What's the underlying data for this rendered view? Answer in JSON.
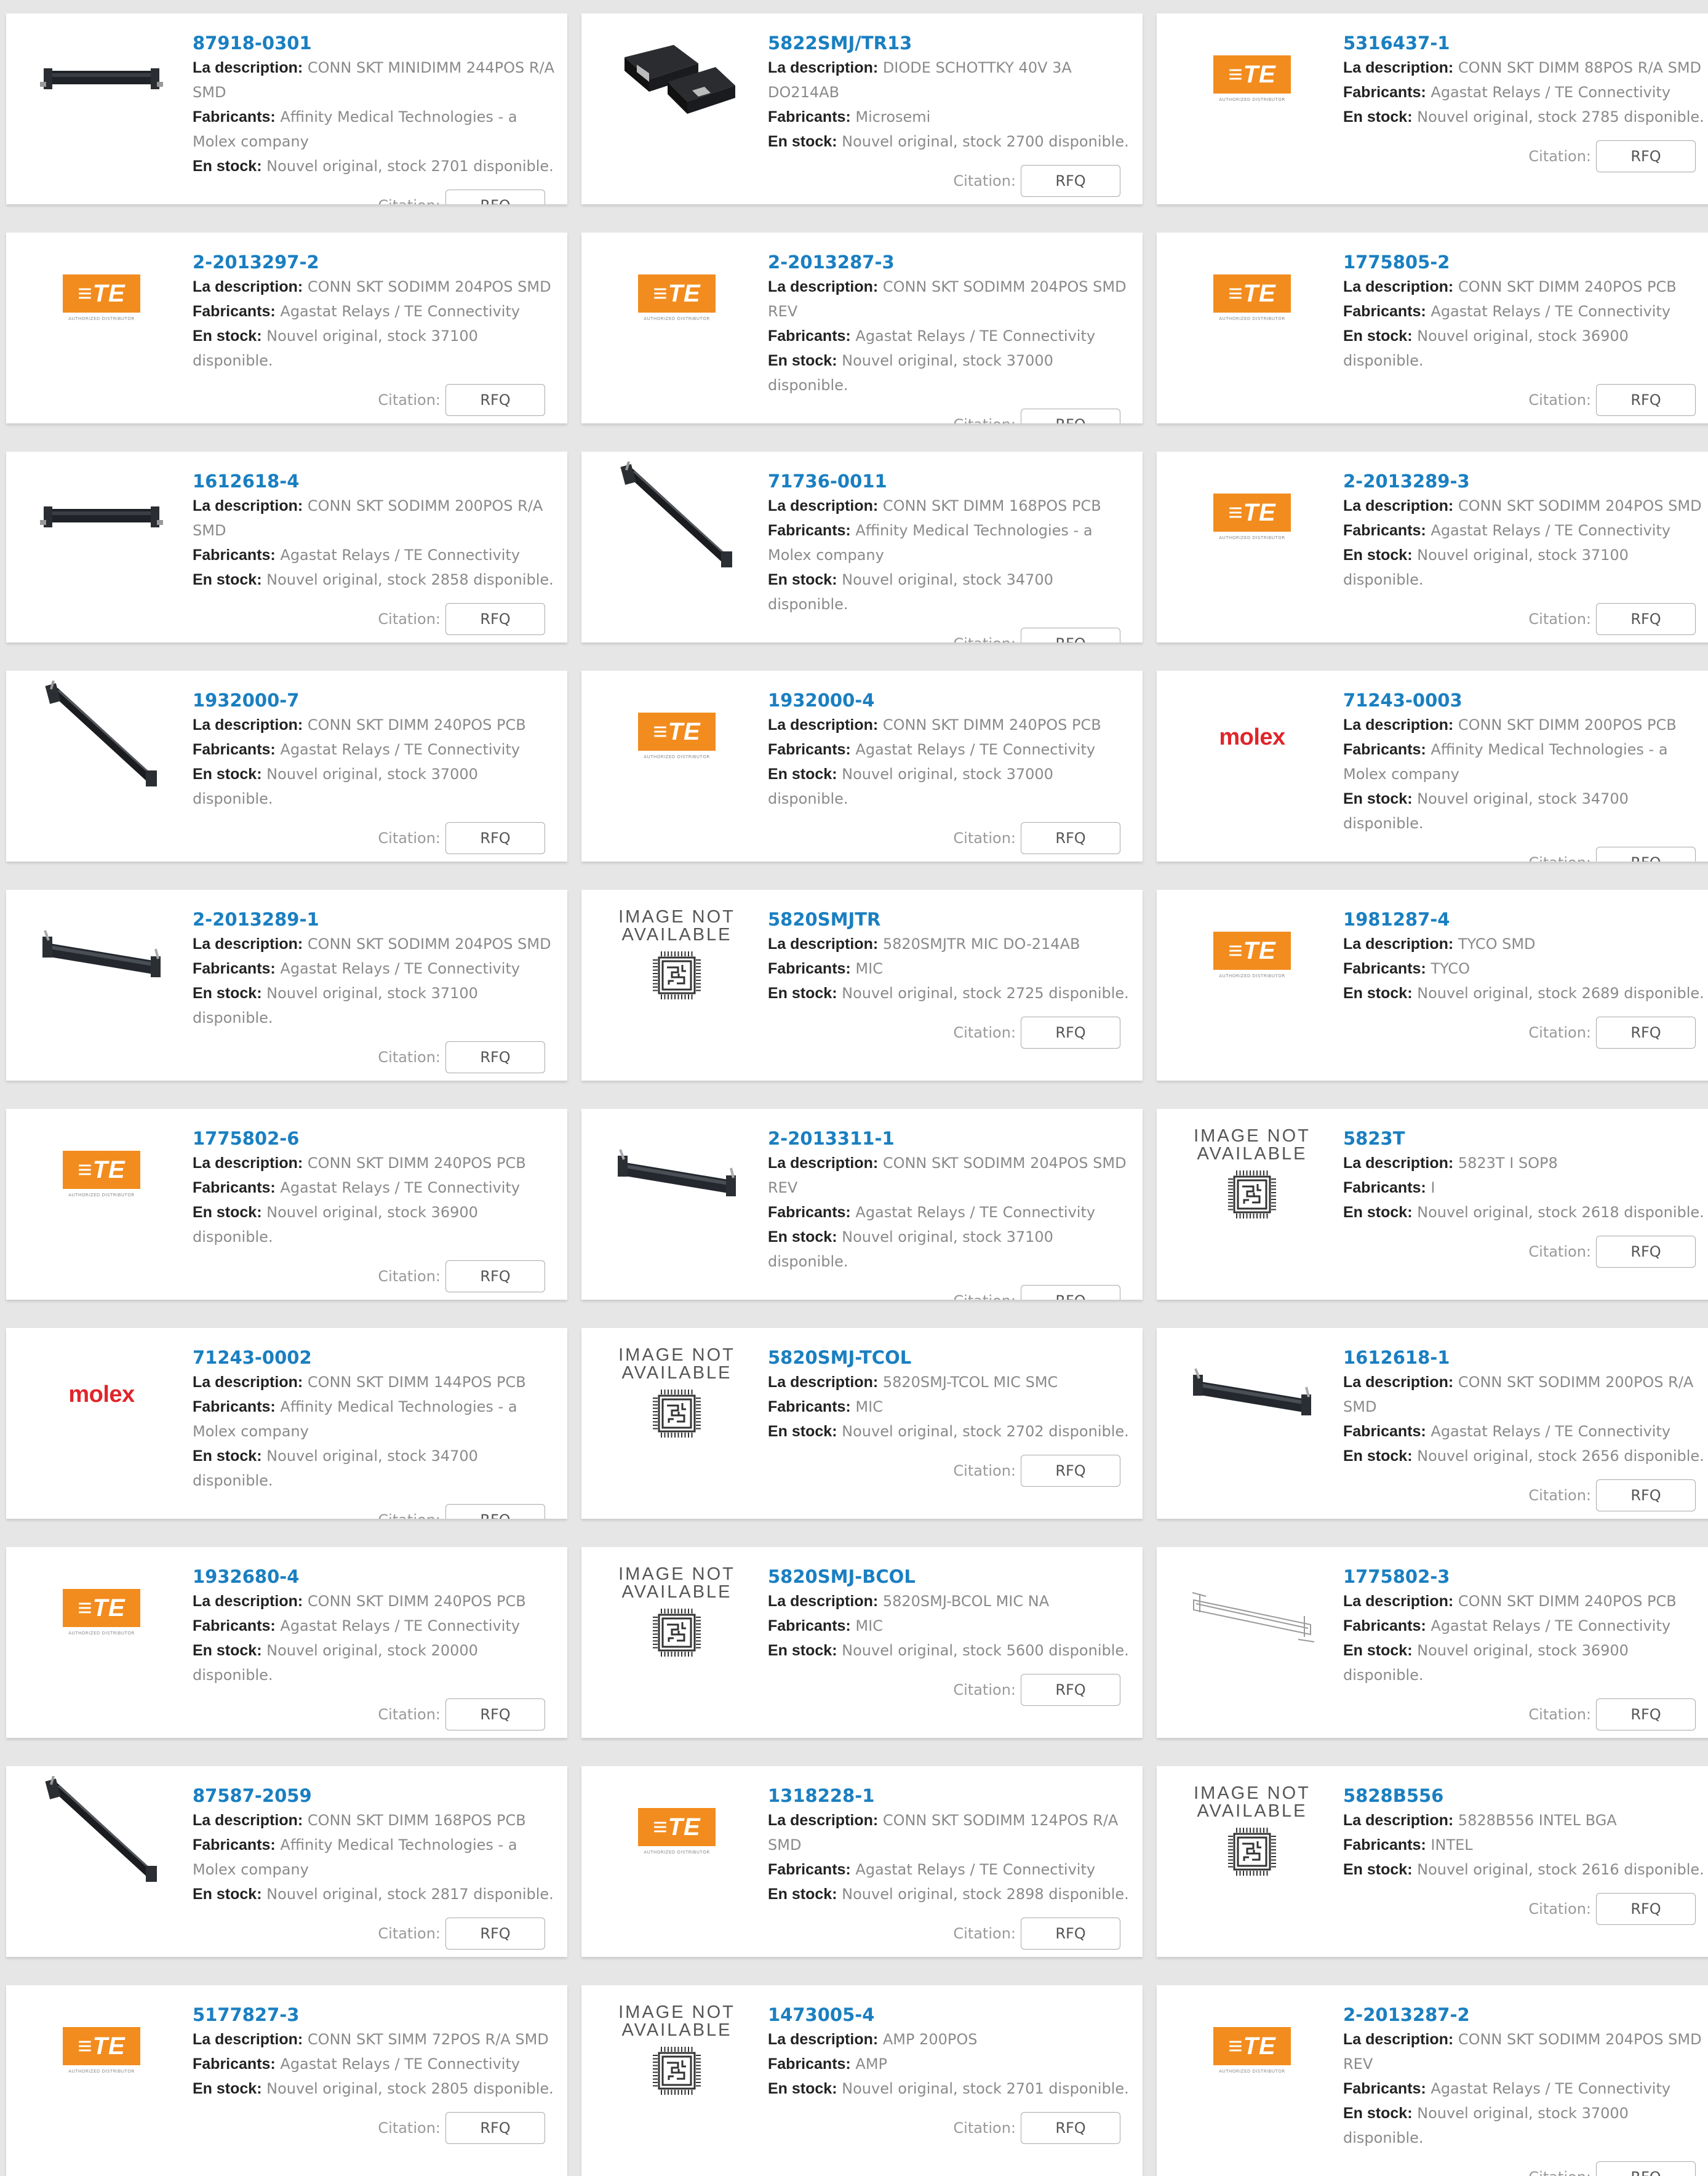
{
  "labels": {
    "description": "La description:",
    "manufacturer": "Fabricants:",
    "stock": "En stock:",
    "citation": "Citation:",
    "rfq": "RFQ"
  },
  "brand": {
    "te_text": "≡TE",
    "te_subtext": "AUTHORIZED DISTRIBUTOR",
    "molex_text": "molex",
    "na_text": "IMAGE NOT AVAILABLE"
  },
  "colors": {
    "part_link": "#1a7fc1",
    "te_orange": "#f28c1e",
    "molex_red": "#e0252a",
    "page_bg": "#e6e6e6"
  },
  "products": [
    {
      "pn": "87918-0301",
      "desc": "CONN SKT MINIDIMM 244POS R/A SMD",
      "mfr": "Affinity Medical Technologies - a Molex company",
      "stock": "Nouvel original, stock 2701 disponible.",
      "img": "socket-flat"
    },
    {
      "pn": "5822SMJ/TR13",
      "desc": "DIODE SCHOTTKY 40V 3A DO214AB",
      "mfr": "Microsemi",
      "stock": "Nouvel original, stock 2700 disponible.",
      "img": "diode"
    },
    {
      "pn": "5316437-1",
      "desc": "CONN SKT DIMM 88POS R/A SMD",
      "mfr": "Agastat Relays / TE Connectivity",
      "stock": "Nouvel original, stock 2785 disponible.",
      "img": "te"
    },
    {
      "pn": "2-2013297-2",
      "desc": "CONN SKT SODIMM 204POS SMD",
      "mfr": "Agastat Relays / TE Connectivity",
      "stock": "Nouvel original, stock 37100 disponible.",
      "img": "te"
    },
    {
      "pn": "2-2013287-3",
      "desc": "CONN SKT SODIMM 204POS SMD REV",
      "mfr": "Agastat Relays / TE Connectivity",
      "stock": "Nouvel original, stock 37000 disponible.",
      "img": "te"
    },
    {
      "pn": "1775805-2",
      "desc": "CONN SKT DIMM 240POS PCB",
      "mfr": "Agastat Relays / TE Connectivity",
      "stock": "Nouvel original, stock 36900 disponible.",
      "img": "te"
    },
    {
      "pn": "1612618-4",
      "desc": "CONN SKT SODIMM 200POS R/A SMD",
      "mfr": "Agastat Relays / TE Connectivity",
      "stock": "Nouvel original, stock 2858 disponible.",
      "img": "socket-flat"
    },
    {
      "pn": "71736-0011",
      "desc": "CONN SKT DIMM 168POS PCB",
      "mfr": "Affinity Medical Technologies - a Molex company",
      "stock": "Nouvel original, stock 34700 disponible.",
      "img": "socket-diag"
    },
    {
      "pn": "2-2013289-3",
      "desc": "CONN SKT SODIMM 204POS SMD",
      "mfr": "Agastat Relays / TE Connectivity",
      "stock": "Nouvel original, stock 37100 disponible.",
      "img": "te"
    },
    {
      "pn": "1932000-7",
      "desc": "CONN SKT DIMM 240POS PCB",
      "mfr": "Agastat Relays / TE Connectivity",
      "stock": "Nouvel original, stock 37000 disponible.",
      "img": "socket-diag"
    },
    {
      "pn": "1932000-4",
      "desc": "CONN SKT DIMM 240POS PCB",
      "mfr": "Agastat Relays / TE Connectivity",
      "stock": "Nouvel original, stock 37000 disponible.",
      "img": "te"
    },
    {
      "pn": "71243-0003",
      "desc": "CONN SKT DIMM 200POS PCB",
      "mfr": "Affinity Medical Technologies - a Molex company",
      "stock": "Nouvel original, stock 34700 disponible.",
      "img": "molex"
    },
    {
      "pn": "2-2013289-1",
      "desc": "CONN SKT SODIMM 204POS SMD",
      "mfr": "Agastat Relays / TE Connectivity",
      "stock": "Nouvel original, stock 37100 disponible.",
      "img": "socket-tilt"
    },
    {
      "pn": "5820SMJTR",
      "desc": "5820SMJTR MIC DO-214AB",
      "mfr": "MIC",
      "stock": "Nouvel original, stock 2725 disponible.",
      "img": "na"
    },
    {
      "pn": "1981287-4",
      "desc": "TYCO SMD",
      "mfr": "TYCO",
      "stock": "Nouvel original, stock 2689 disponible.",
      "img": "te"
    },
    {
      "pn": "1775802-6",
      "desc": "CONN SKT DIMM 240POS PCB",
      "mfr": "Agastat Relays / TE Connectivity",
      "stock": "Nouvel original, stock 36900 disponible.",
      "img": "te"
    },
    {
      "pn": "2-2013311-1",
      "desc": "CONN SKT SODIMM 204POS SMD REV",
      "mfr": "Agastat Relays / TE Connectivity",
      "stock": "Nouvel original, stock 37100 disponible.",
      "img": "socket-tilt"
    },
    {
      "pn": "5823T",
      "desc": "5823T I SOP8",
      "mfr": "I",
      "stock": "Nouvel original, stock 2618 disponible.",
      "img": "na"
    },
    {
      "pn": "71243-0002",
      "desc": "CONN SKT DIMM 144POS PCB",
      "mfr": "Affinity Medical Technologies - a Molex company",
      "stock": "Nouvel original, stock 34700 disponible.",
      "img": "molex"
    },
    {
      "pn": "5820SMJ-TCOL",
      "desc": "5820SMJ-TCOL MIC SMC",
      "mfr": "MIC",
      "stock": "Nouvel original, stock 2702 disponible.",
      "img": "na"
    },
    {
      "pn": "1612618-1",
      "desc": "CONN SKT SODIMM 200POS R/A SMD",
      "mfr": "Agastat Relays / TE Connectivity",
      "stock": "Nouvel original, stock 2656 disponible.",
      "img": "socket-tilt"
    },
    {
      "pn": "1932680-4",
      "desc": "CONN SKT DIMM 240POS PCB",
      "mfr": "Agastat Relays / TE Connectivity",
      "stock": "Nouvel original, stock 20000 disponible.",
      "img": "te"
    },
    {
      "pn": "5820SMJ-BCOL",
      "desc": "5820SMJ-BCOL MIC NA",
      "mfr": "MIC",
      "stock": "Nouvel original, stock 5600 disponible.",
      "img": "na"
    },
    {
      "pn": "1775802-3",
      "desc": "CONN SKT DIMM 240POS PCB",
      "mfr": "Agastat Relays / TE Connectivity",
      "stock": "Nouvel original, stock 36900 disponible.",
      "img": "socket-line"
    },
    {
      "pn": "87587-2059",
      "desc": "CONN SKT DIMM 168POS PCB",
      "mfr": "Affinity Medical Technologies - a Molex company",
      "stock": "Nouvel original, stock 2817 disponible.",
      "img": "socket-diag"
    },
    {
      "pn": "1318228-1",
      "desc": "CONN SKT SODIMM 124POS R/A SMD",
      "mfr": "Agastat Relays / TE Connectivity",
      "stock": "Nouvel original, stock 2898 disponible.",
      "img": "te"
    },
    {
      "pn": "5828B556",
      "desc": "5828B556 INTEL BGA",
      "mfr": "INTEL",
      "stock": "Nouvel original, stock 2616 disponible.",
      "img": "na"
    },
    {
      "pn": "5177827-3",
      "desc": "CONN SKT SIMM 72POS R/A SMD",
      "mfr": "Agastat Relays / TE Connectivity",
      "stock": "Nouvel original, stock 2805 disponible.",
      "img": "te"
    },
    {
      "pn": "1473005-4",
      "desc": "AMP 200POS",
      "mfr": "AMP",
      "stock": "Nouvel original, stock 2701 disponible.",
      "img": "na"
    },
    {
      "pn": "2-2013287-2",
      "desc": "CONN SKT SODIMM 204POS SMD REV",
      "mfr": "Agastat Relays / TE Connectivity",
      "stock": "Nouvel original, stock 37000 disponible.",
      "img": "te"
    }
  ]
}
